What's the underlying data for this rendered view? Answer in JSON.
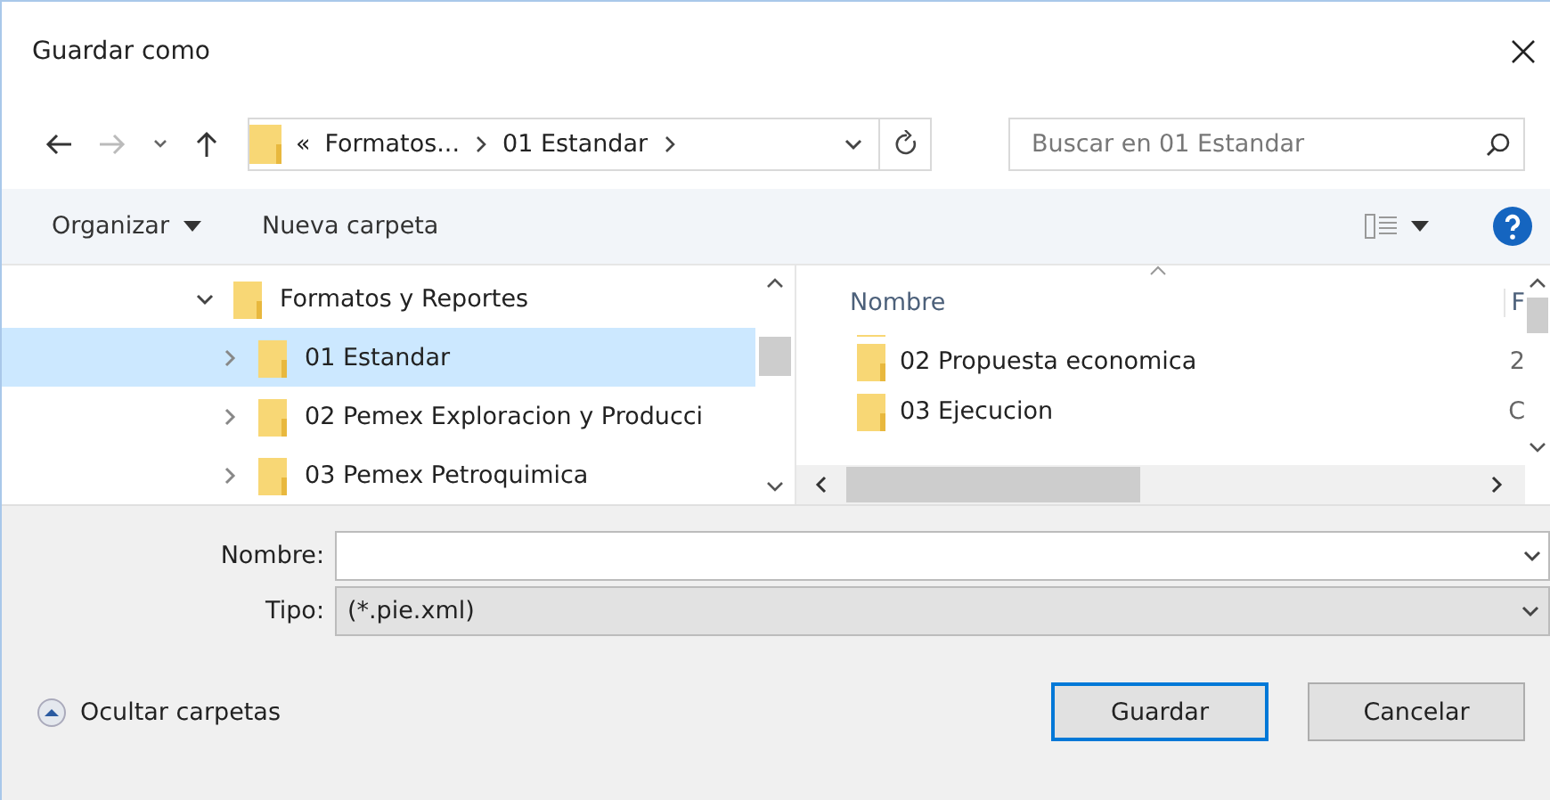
{
  "window": {
    "title": "Guardar como"
  },
  "address_bar": {
    "overflow": "«",
    "crumbs": [
      "Formatos...",
      "01 Estandar"
    ]
  },
  "search": {
    "placeholder": "Buscar en 01 Estandar"
  },
  "toolbar": {
    "organize": "Organizar",
    "new_folder": "Nueva carpeta"
  },
  "tree": [
    {
      "label": "Formatos y Reportes",
      "expanded": true,
      "selected": false,
      "children": [
        {
          "label": "01 Estandar",
          "expanded": false,
          "selected": true
        },
        {
          "label": "02 Pemex Exploracion y Producci",
          "expanded": false,
          "selected": false
        },
        {
          "label": "03 Pemex Petroquimica",
          "expanded": false,
          "selected": false
        }
      ]
    }
  ],
  "file_list": {
    "columns": [
      "Nombre",
      "F"
    ],
    "rows": [
      {
        "name": "02 Propuesta economica",
        "column_2": "2"
      },
      {
        "name": "03 Ejecucion",
        "column_2": "C"
      }
    ]
  },
  "form": {
    "name_label": "Nombre:",
    "type_label": "Tipo:",
    "type_value": "(*.pie.xml)"
  },
  "hide_folders": "Ocultar carpetas",
  "buttons": [
    {
      "label": "Guardar",
      "default": true
    },
    {
      "label": "Cancelar",
      "default": false
    }
  ]
}
